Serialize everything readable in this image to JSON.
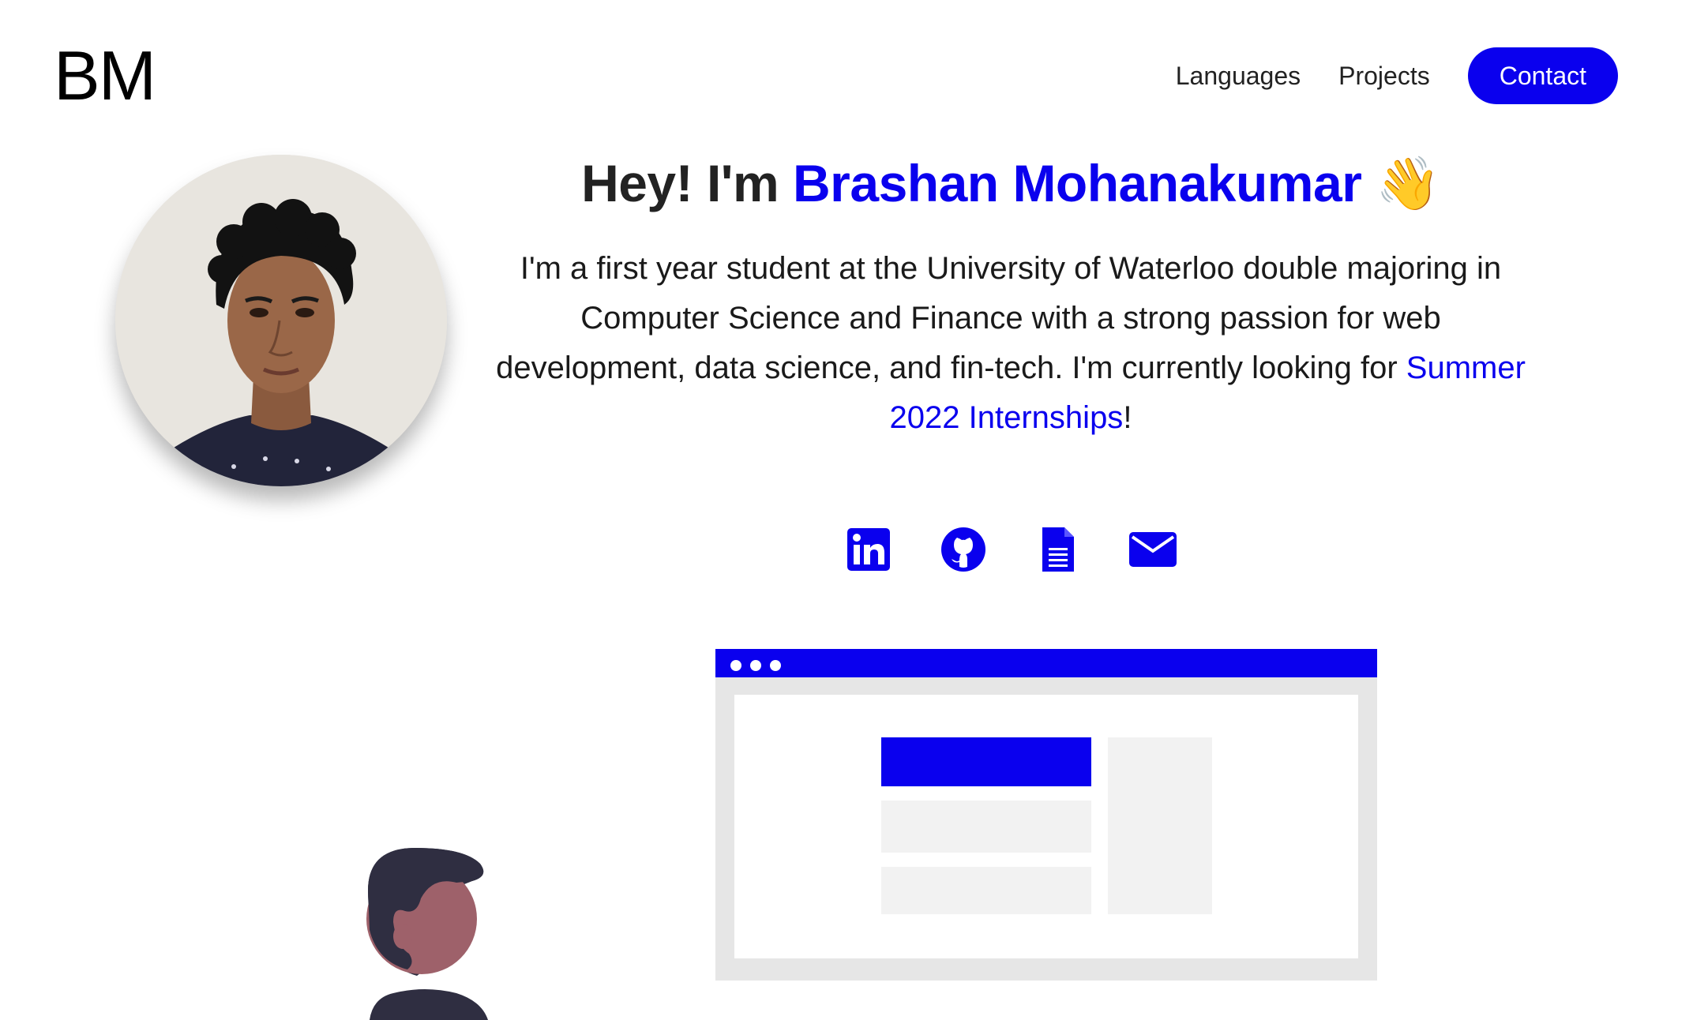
{
  "header": {
    "logo": "BM",
    "nav": [
      {
        "label": "Languages"
      },
      {
        "label": "Projects"
      }
    ],
    "contact_label": "Contact"
  },
  "hero": {
    "greeting": "Hey! I'm",
    "name": "Brashan Mohanakumar",
    "wave_emoji": "👋",
    "intro_text": "I'm a first year student at the University of Waterloo double majoring in Computer Science and Finance with a strong passion for web development, data science, and fin-tech. I'm currently looking for",
    "internship_link": "Summer 2022 Internships",
    "intro_end": "!"
  },
  "socials": [
    {
      "icon": "linkedin-icon"
    },
    {
      "icon": "github-icon"
    },
    {
      "icon": "resume-document-icon"
    },
    {
      "icon": "email-envelope-icon"
    }
  ],
  "colors": {
    "accent": "#0a00ee",
    "text": "#1a1a1a",
    "illustration_gray": "#e6e6e6",
    "illustration_light": "#f2f2f2",
    "person_hair": "#2f2e41",
    "person_skin": "#9e616a"
  }
}
